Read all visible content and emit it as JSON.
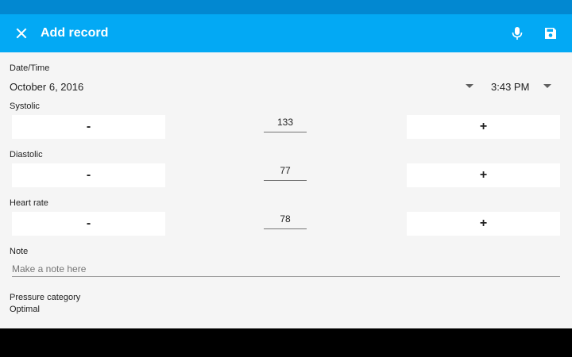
{
  "app": {
    "title": "Add record",
    "colors": {
      "appbar": "#03a9f4",
      "statusbar": "#0288d1",
      "background": "#f5f5f5"
    },
    "icons": {
      "close": "close-icon",
      "mic": "microphone-icon",
      "save": "save-icon"
    }
  },
  "datetime": {
    "label": "Date/Time",
    "date": "October 6, 2016",
    "time": "3:43 PM"
  },
  "systolic": {
    "label": "Systolic",
    "minus": "-",
    "value": "133",
    "plus": "+"
  },
  "diastolic": {
    "label": "Diastolic",
    "minus": "-",
    "value": "77",
    "plus": "+"
  },
  "heart_rate": {
    "label": "Heart rate",
    "minus": "-",
    "value": "78",
    "plus": "+"
  },
  "note": {
    "label": "Note",
    "placeholder": "Make a note here",
    "value": ""
  },
  "category": {
    "label": "Pressure category",
    "value": "Optimal"
  }
}
